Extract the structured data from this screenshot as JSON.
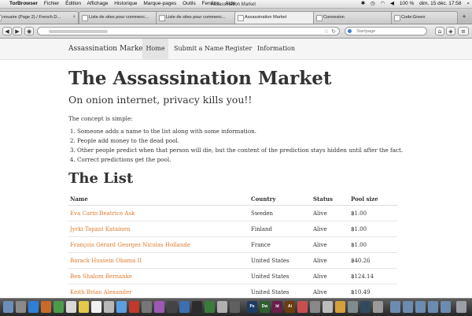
{
  "menubar": {
    "app": "TorBrowser",
    "menus": [
      "Fichier",
      "Édition",
      "Affichage",
      "Historique",
      "Marque-pages",
      "Outils",
      "Fenêtre",
      "Aide"
    ],
    "window_title": "Assassination Market",
    "battery": "100 %",
    "datetime": "dim. 15 déc.  17:58"
  },
  "tabs": [
    {
      "label": "nnuaire (Page 2) / French D..."
    },
    {
      "label": "Liste de sites pour commenc..."
    },
    {
      "label": "Liste de sites pour commenc..."
    },
    {
      "label": "Assassination Market"
    },
    {
      "label": "Connexion"
    },
    {
      "label": "Code:Green"
    }
  ],
  "toolbar": {
    "search_placeholder": "Startpage"
  },
  "site": {
    "brand": "Assassination Market",
    "nav": [
      "Home",
      "Submit a Name",
      "Register",
      "Information"
    ],
    "title": "The Assassination Market",
    "lead": "On onion internet, privacy kills you!!",
    "concept_intro": "The concept is simple:",
    "rules": [
      "Someone adds a name to the list along with some information.",
      "People add money to the dead pool.",
      "Other people predict when that person will die, but the content of the prediction stays hidden until after the fact.",
      "Correct predictions get the pool."
    ],
    "list_title": "The List",
    "columns": [
      "Name",
      "Country",
      "Status",
      "Pool size"
    ],
    "rows": [
      {
        "name": "Eva Carin Beatrice Ask",
        "country": "Sweden",
        "status": "Alive",
        "pool": "฿1.00"
      },
      {
        "name": "Jyrki Tapani Katainen",
        "country": "Finland",
        "status": "Alive",
        "pool": "฿1.00"
      },
      {
        "name": "François Gérard Georges Nicolas Hollande",
        "country": "France",
        "status": "Alive",
        "pool": "฿1.00"
      },
      {
        "name": "Barack Hussein Obama II",
        "country": "United States",
        "status": "Alive",
        "pool": "฿40.26"
      },
      {
        "name": "Ben Shalom Bernanke",
        "country": "United States",
        "status": "Alive",
        "pool": "฿124.14"
      },
      {
        "name": "Keith Brian Alexander",
        "country": "United States",
        "status": "Alive",
        "pool": "฿10.49"
      }
    ]
  },
  "dock": {
    "labels": [
      "Ps",
      "Dw",
      "Id",
      "Ai"
    ]
  }
}
